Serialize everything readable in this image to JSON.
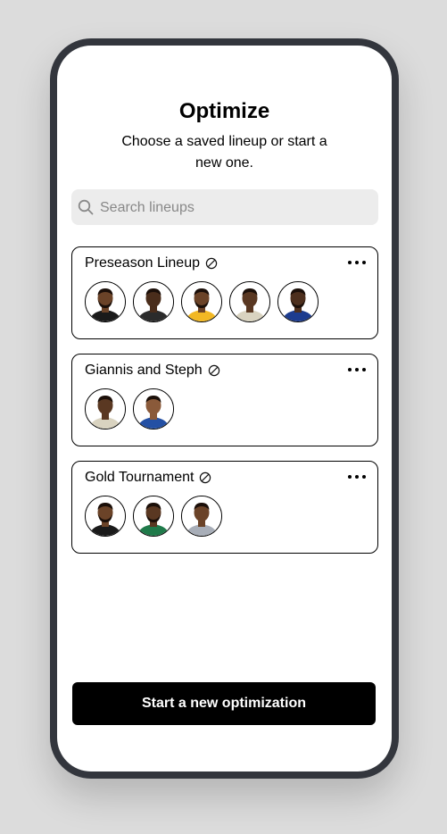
{
  "header": {
    "title": "Optimize",
    "subtitle": "Choose a saved lineup or start a new one."
  },
  "search": {
    "placeholder": "Search lineups",
    "value": "",
    "icon": "search-icon"
  },
  "lineups": [
    {
      "name": "Preseason Lineup",
      "badge_icon": "circle-slash-icon",
      "menu_icon": "more-horizontal-icon",
      "players": [
        {
          "skin": "#6b4328",
          "jersey": "#1a1a1a",
          "hair": "#1b0f09",
          "beard": true
        },
        {
          "skin": "#4a2d1b",
          "jersey": "#2b2b2b",
          "hair": "#1b0f09",
          "beard": false
        },
        {
          "skin": "#6b4328",
          "jersey": "#f2b824",
          "hair": "#1b0f09",
          "beard": true
        },
        {
          "skin": "#5a3822",
          "jersey": "#d9d3c0",
          "hair": "#1b0f09",
          "beard": false
        },
        {
          "skin": "#4d2f1d",
          "jersey": "#1d3c8f",
          "hair": "#1b0f09",
          "beard": true
        }
      ]
    },
    {
      "name": "Giannis and Steph",
      "badge_icon": "circle-slash-icon",
      "menu_icon": "more-horizontal-icon",
      "players": [
        {
          "skin": "#5a3822",
          "jersey": "#d9d3c0",
          "hair": "#1b0f09",
          "beard": false
        },
        {
          "skin": "#8a5a3a",
          "jersey": "#2450a4",
          "hair": "#1b0f09",
          "beard": false
        }
      ]
    },
    {
      "name": "Gold Tournament",
      "badge_icon": "circle-slash-icon",
      "menu_icon": "more-horizontal-icon",
      "players": [
        {
          "skin": "#6b4328",
          "jersey": "#1a1a1a",
          "hair": "#1b0f09",
          "beard": true
        },
        {
          "skin": "#5a3822",
          "jersey": "#1f7a4a",
          "hair": "#1b0f09",
          "beard": true
        },
        {
          "skin": "#6b4328",
          "jersey": "#a8aeb8",
          "hair": "#1b0f09",
          "beard": false
        }
      ]
    }
  ],
  "cta": {
    "label": "Start a new optimization"
  },
  "colors": {
    "background": "#dcdcdc",
    "phone_frame": "#33363d",
    "button_bg": "#000000",
    "button_text": "#ffffff",
    "search_bg": "#ececec"
  }
}
